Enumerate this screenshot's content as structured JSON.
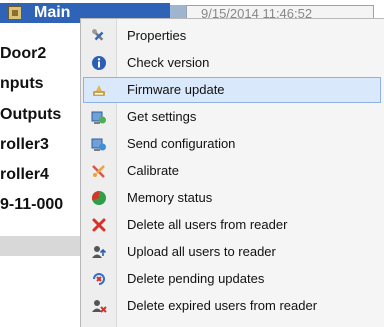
{
  "header": {
    "root_label": "Main",
    "status_text": "9/15/2014 11:46:52"
  },
  "tree": {
    "items": [
      "Door2",
      "nputs",
      "Outputs",
      "roller3",
      "roller4",
      "9-11-000"
    ]
  },
  "menu": {
    "items": [
      {
        "label": "Properties",
        "icon": "tools-icon"
      },
      {
        "label": "Check version",
        "icon": "info-icon"
      },
      {
        "label": "Firmware update",
        "icon": "firmware-icon",
        "highlighted": true
      },
      {
        "label": "Get settings",
        "icon": "get-settings-icon"
      },
      {
        "label": "Send configuration",
        "icon": "send-config-icon"
      },
      {
        "label": "Calibrate",
        "icon": "calibrate-icon"
      },
      {
        "label": "Memory status",
        "icon": "memory-pie-icon"
      },
      {
        "label": "Delete all users from reader",
        "icon": "delete-x-icon"
      },
      {
        "label": "Upload all users to reader",
        "icon": "upload-users-icon"
      },
      {
        "label": "Delete pending updates",
        "icon": "delete-pending-icon"
      },
      {
        "label": "Delete expired users from reader",
        "icon": "delete-expired-users-icon"
      }
    ]
  },
  "colors": {
    "selection_blue": "#2e63b8",
    "menu_hover": "#d9e8fb",
    "menu_hover_border": "#8db2e3",
    "menu_bg": "#f5f5f5"
  }
}
